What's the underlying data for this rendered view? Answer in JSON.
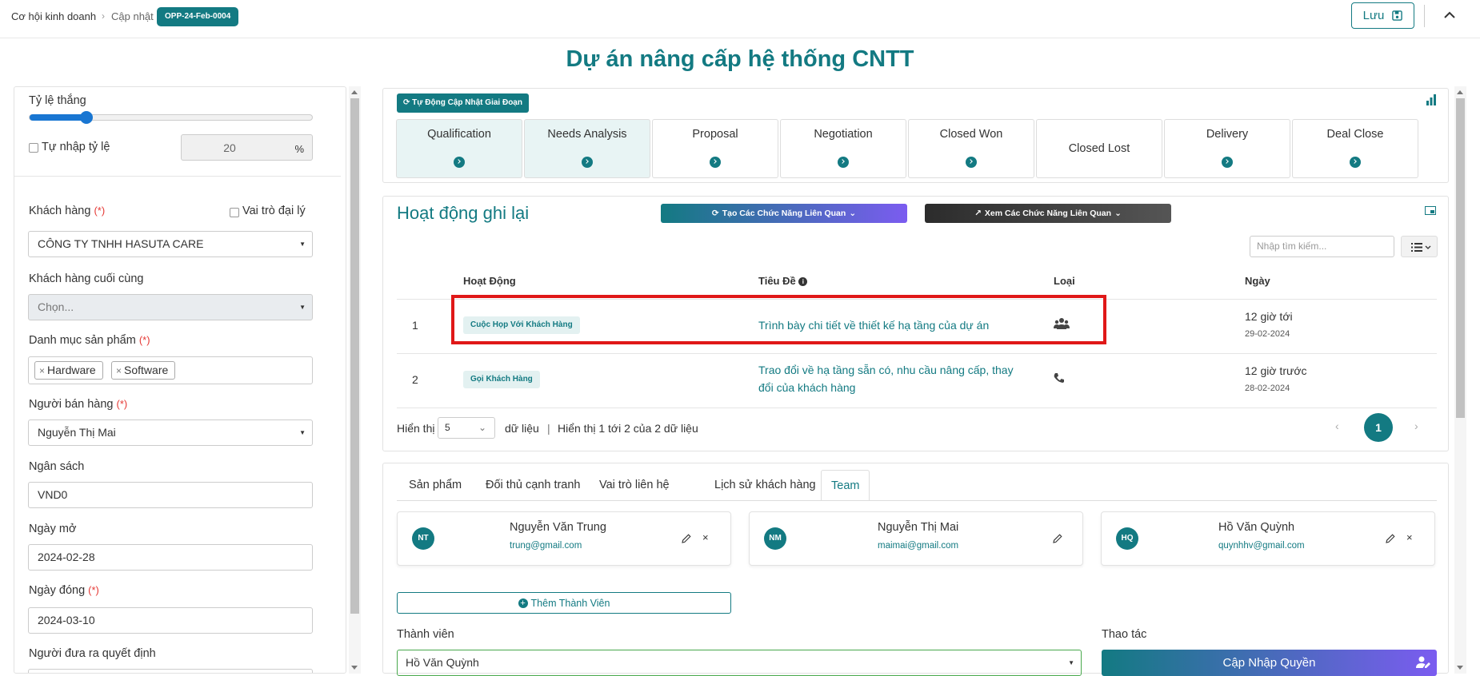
{
  "breadcrumb": {
    "root": "Cơ hội kinh doanh",
    "separator": "›",
    "current": "Cập nhật",
    "badge": "OPP-24-Feb-0004"
  },
  "header": {
    "save_label": "Lưu"
  },
  "page_title": "Dự án nâng cấp hệ thống CNTT",
  "left_panel": {
    "win_rate_label": "Tỷ lệ thắng",
    "win_rate_slider": 20,
    "manual_rate_label": "Tự nhập tỷ lệ",
    "manual_rate_value": "20",
    "rate_unit": "%",
    "customer_label": "Khách hàng",
    "required_mark": "(*)",
    "agent_role_label": "Vai trò đại lý",
    "customer_value": "CÔNG TY TNHH HASUTA CARE",
    "end_customer_label": "Khách hàng cuối cùng",
    "end_customer_placeholder": "Chọn...",
    "product_category_label": "Danh mục sản phẩm",
    "product_tags": [
      "Hardware",
      "Software"
    ],
    "tag_remove": "×",
    "seller_label": "Người bán hàng",
    "seller_value": "Nguyễn Thị Mai",
    "budget_label": "Ngân sách",
    "budget_value": "VND0",
    "open_date_label": "Ngày mở",
    "open_date_value": "2024-02-28",
    "close_date_label": "Ngày đóng",
    "close_date_value": "2024-03-10",
    "decision_maker_label": "Người đưa ra quyết định"
  },
  "stages": {
    "auto_update_label": "Tự Động Cập Nhật Giai Đoạn",
    "items": [
      {
        "name": "Qualification",
        "active": true,
        "dot": true
      },
      {
        "name": "Needs Analysis",
        "active": true,
        "dot": true
      },
      {
        "name": "Proposal",
        "active": false,
        "dot": true
      },
      {
        "name": "Negotiation",
        "active": false,
        "dot": true
      },
      {
        "name": "Closed Won",
        "active": false,
        "dot": true
      },
      {
        "name": "Closed Lost",
        "active": false,
        "dot": false
      },
      {
        "name": "Delivery",
        "active": false,
        "dot": true
      },
      {
        "name": "Deal Close",
        "active": false,
        "dot": true
      }
    ]
  },
  "activities": {
    "title": "Hoạt động ghi lại",
    "create_button": "Tạo Các Chức Năng Liên Quan",
    "view_button": "Xem Các Chức Năng Liên Quan",
    "search_placeholder": "Nhập tìm kiếm...",
    "columns": {
      "activity": "Hoạt Động",
      "title": "Tiêu Đề",
      "type": "Loại",
      "date": "Ngày"
    },
    "rows": [
      {
        "index": "1",
        "activity": "Cuộc Họp Với Khách Hàng",
        "title": "Trình bày chi tiết về thiết kế hạ tầng của dự án",
        "type_icon": "meeting-icon",
        "relative": "12 giờ tới",
        "date": "29-02-2024"
      },
      {
        "index": "2",
        "activity": "Gọi Khách Hàng",
        "title_line1": "Trao đổi về hạ tầng sẵn có, nhu cầu nâng cấp, thay",
        "title_line2": "đổi của khách hàng",
        "type_icon": "phone-icon",
        "relative": "12 giờ trước",
        "date": "28-02-2024"
      }
    ],
    "footer": {
      "show_label": "Hiển thị",
      "page_size": "5",
      "records_label": "dữ liệu",
      "divider": "|",
      "summary": "Hiển thị 1 tới 2 của 2 dữ liệu",
      "current_page": "1",
      "prev": "‹",
      "next": "›"
    }
  },
  "team": {
    "tabs": [
      {
        "label": "Sản phẩm",
        "active": false
      },
      {
        "label": "Đối thủ cạnh tranh",
        "active": false
      },
      {
        "label": "Vai trò liên hệ",
        "active": false
      },
      {
        "label": "Lịch sử khách hàng",
        "active": false
      },
      {
        "label": "Team",
        "active": true
      }
    ],
    "members": [
      {
        "initials": "NT",
        "name": "Nguyễn Văn Trung",
        "email": "trung@gmail.com",
        "removable": true
      },
      {
        "initials": "NM",
        "name": "Nguyễn Thị Mai",
        "email": "maimai@gmail.com",
        "removable": false
      },
      {
        "initials": "HQ",
        "name": "Hồ Văn Quỳnh",
        "email": "quynhhv@gmail.com",
        "removable": true
      }
    ],
    "remove_glyph": "×",
    "add_member_label": "Thêm Thành Viên",
    "member_label": "Thành viên",
    "member_value": "Hồ Văn Quỳnh",
    "action_label": "Thao tác",
    "update_permission_label": "Cập Nhập Quyền"
  },
  "colors": {
    "brand": "#137a82",
    "highlight": "#e01818",
    "slider": "#1976d2",
    "gradient_end": "#7b5cf0"
  }
}
